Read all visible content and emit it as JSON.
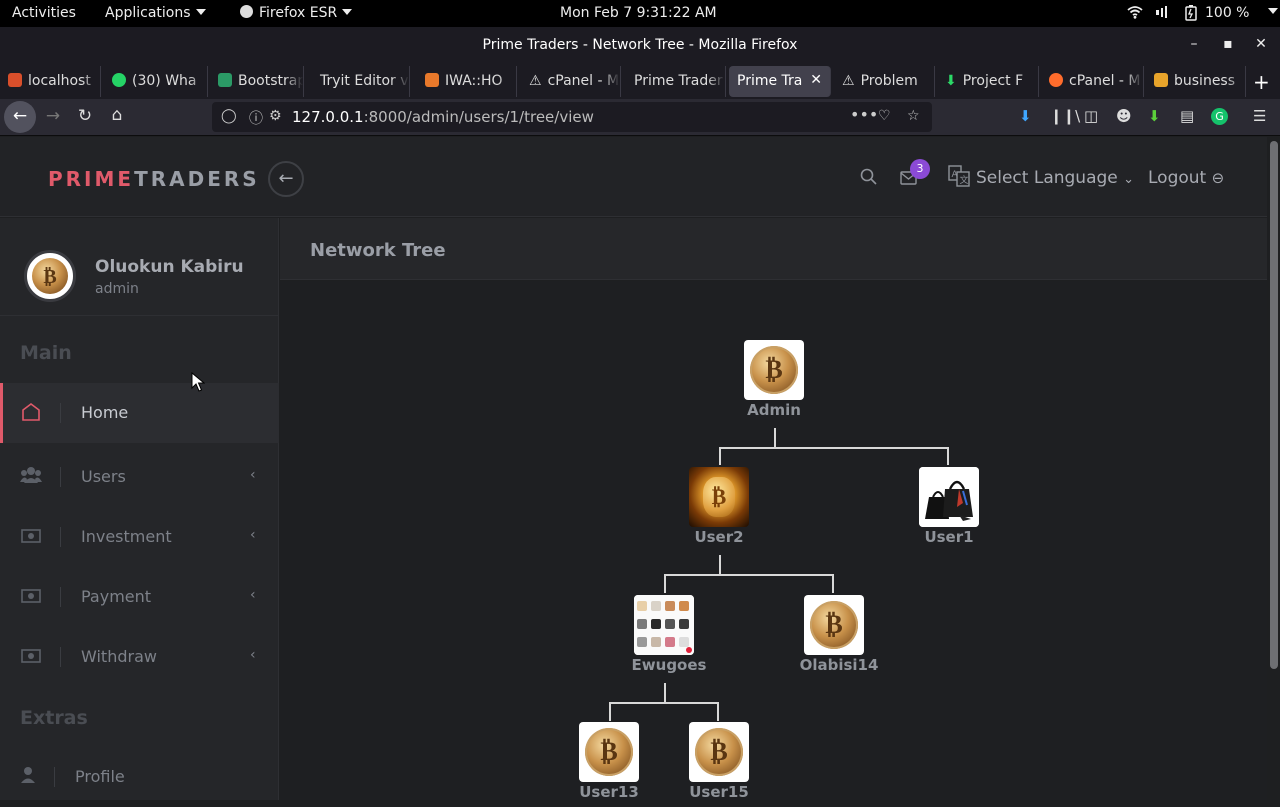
{
  "system_bar": {
    "activities": "Activities",
    "applications": "Applications",
    "browser_app": "Firefox ESR",
    "datetime": "Mon Feb 7   9:31:22 AM",
    "battery": "100 %"
  },
  "window": {
    "title": "Prime Traders - Network Tree - Mozilla Firefox"
  },
  "tabs": [
    {
      "label": "localhost",
      "favicon_color": "#d94f2b"
    },
    {
      "label": "(30) Wha",
      "favicon_color": "#25d366"
    },
    {
      "label": "Bootstrap",
      "favicon_color": "#2b9a66"
    },
    {
      "label": "Tryit Editor v",
      "favicon_color": ""
    },
    {
      "label": "IWA::HO",
      "favicon_color": "#e8792b"
    },
    {
      "label": "cPanel - M",
      "favicon_color": "#dddddd"
    },
    {
      "label": "Prime Trader",
      "favicon_color": ""
    },
    {
      "label": "Prime Tra",
      "favicon_color": "",
      "active": true
    },
    {
      "label": "Problem",
      "favicon_color": "#dddddd"
    },
    {
      "label": "Project F",
      "favicon_color": "#2bd967"
    },
    {
      "label": "cPanel - M",
      "favicon_color": "#ff6c2c"
    },
    {
      "label": "business",
      "favicon_color": "#e8a42b"
    }
  ],
  "address_bar": {
    "host": "127.0.0.1",
    "path": ":8000/admin/users/1/tree/view"
  },
  "header": {
    "brand_prime": "PRIME",
    "brand_traders": "TRADERS",
    "notification_count": "3",
    "language_label": "Select Language",
    "logout_label": "Logout"
  },
  "sidebar": {
    "user_name": "Oluokun Kabiru",
    "user_role": "admin",
    "section_main": "Main",
    "section_extras": "Extras",
    "items": [
      {
        "label": "Home",
        "icon": "home-icon"
      },
      {
        "label": "Users",
        "icon": "users-icon"
      },
      {
        "label": "Investment",
        "icon": "money-icon"
      },
      {
        "label": "Payment",
        "icon": "money-icon"
      },
      {
        "label": "Withdraw",
        "icon": "money-icon"
      },
      {
        "label": "Profile",
        "icon": "user-icon"
      }
    ]
  },
  "main": {
    "page_title": "Network Tree"
  },
  "tree": {
    "root": "Admin",
    "level1": [
      "User2",
      "User1"
    ],
    "level2": [
      "Ewugoes",
      "Olabisi14"
    ],
    "level3": [
      "User13",
      "User15"
    ]
  },
  "colors": {
    "accent": "#e05a6a",
    "badge": "#8b4ad6"
  }
}
